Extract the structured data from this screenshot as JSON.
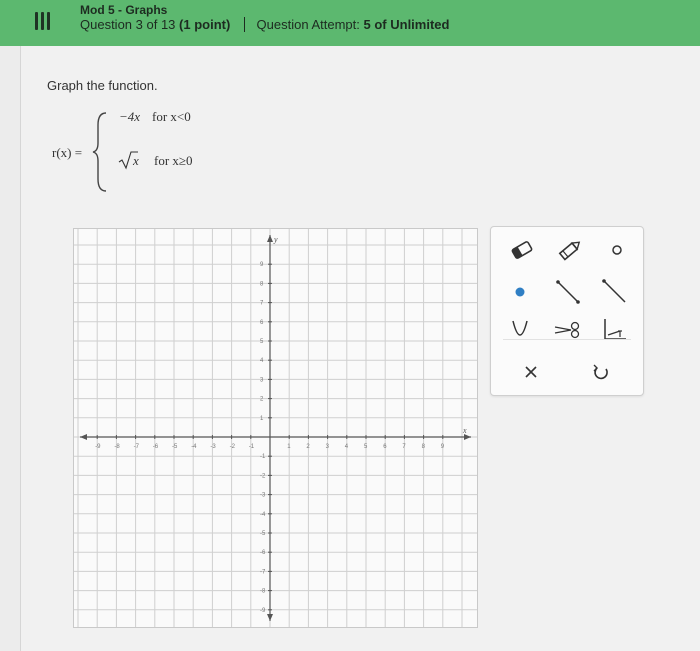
{
  "header": {
    "course": "Mod 5 - Graphs",
    "question": "Question 3 of 13",
    "points": "(1 point)",
    "attempt_label": "Question Attempt:",
    "attempt_value": "5 of Unlimited",
    "bg_color": "#5cb86f"
  },
  "problem": {
    "prompt": "Graph the function.",
    "lhs": "r(x) =",
    "piece1_expr": "−4x",
    "piece1_cond": "for x<0",
    "piece2_expr": "x",
    "piece2_cond": "for x≥0"
  },
  "graph": {
    "x_axis_label": "x",
    "y_axis_label": "y",
    "x_ticks": [
      "-9",
      "-8",
      "-7",
      "-6",
      "-5",
      "-4",
      "-3",
      "-2",
      "-1",
      "1",
      "2",
      "3",
      "4",
      "5",
      "6",
      "7",
      "8",
      "9"
    ],
    "y_ticks": [
      "9",
      "8",
      "7",
      "6",
      "5",
      "4",
      "3",
      "2",
      "1",
      "-1",
      "-2",
      "-3",
      "-4",
      "-5",
      "-6",
      "-7",
      "-8",
      "-9"
    ],
    "xlim": [
      -10,
      10
    ],
    "ylim": [
      -10,
      10
    ]
  },
  "tools": [
    {
      "name": "eraser-icon"
    },
    {
      "name": "pencil-icon"
    },
    {
      "name": "open-circle-icon"
    },
    {
      "name": "filled-dot-icon"
    },
    {
      "name": "line-segment-icon"
    },
    {
      "name": "ray-icon"
    },
    {
      "name": "parabola-icon"
    },
    {
      "name": "scissors-icon"
    },
    {
      "name": "piecewise-icon"
    },
    {
      "name": "clear-icon"
    },
    {
      "name": "undo-icon"
    }
  ],
  "accent_color": "#2f7fc4"
}
